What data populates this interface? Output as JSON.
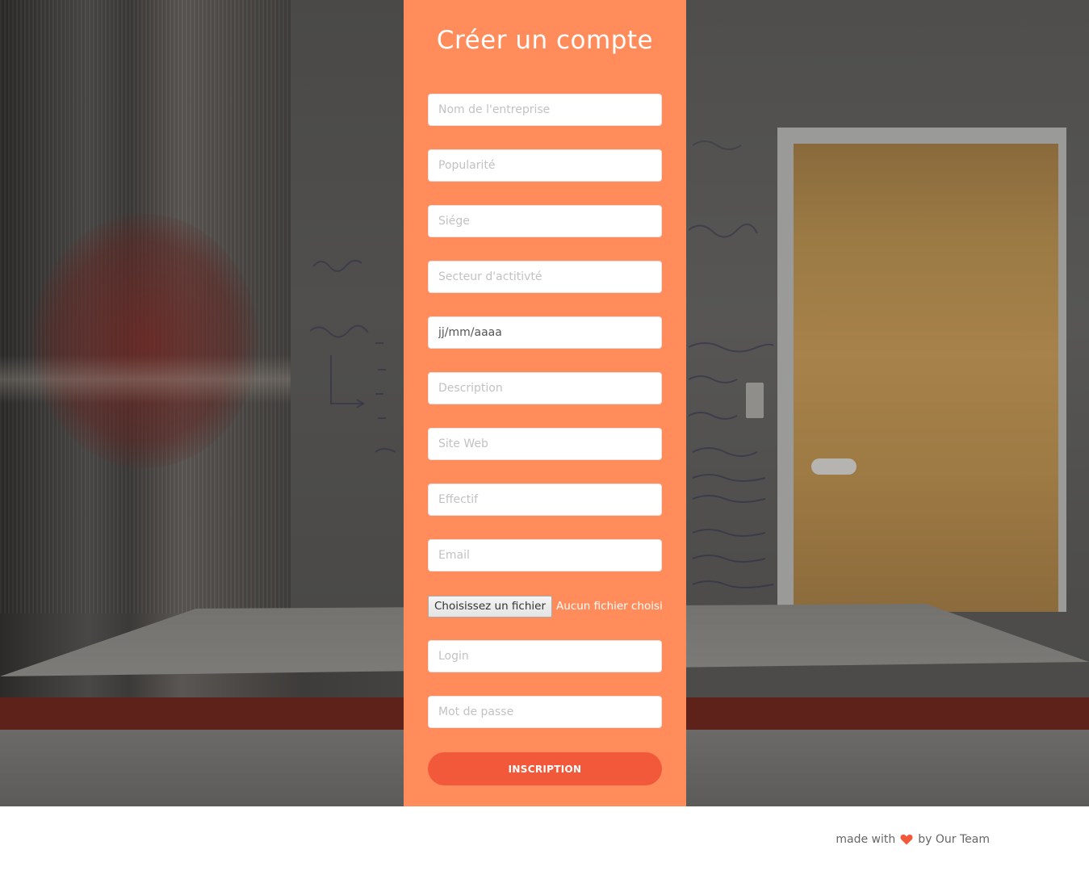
{
  "form": {
    "title": "Créer un compte",
    "fields": {
      "company_name": {
        "placeholder": "Nom de l'entreprise",
        "value": ""
      },
      "popularity": {
        "placeholder": "Popularité",
        "value": ""
      },
      "headquarters": {
        "placeholder": "Siége",
        "value": ""
      },
      "sector": {
        "placeholder": "Secteur d'actitivté",
        "value": ""
      },
      "date": {
        "placeholder": "jj/mm/aaaa",
        "value": ""
      },
      "description": {
        "placeholder": "Description",
        "value": ""
      },
      "website": {
        "placeholder": "Site Web",
        "value": ""
      },
      "headcount": {
        "placeholder": "Effectif",
        "value": ""
      },
      "email": {
        "placeholder": "Email",
        "value": ""
      },
      "login": {
        "placeholder": "Login",
        "value": ""
      },
      "password": {
        "placeholder": "Mot de passe",
        "value": ""
      }
    },
    "file_upload": {
      "button_label": "Choisissez un fichier",
      "status": "Aucun fichier choisi"
    },
    "submit_label": "INSCRIPTION"
  },
  "footer": {
    "made_with": "made with",
    "by": "by Our Team",
    "heart_icon": "heart-icon"
  },
  "colors": {
    "panel": "#ff8c5a",
    "submit": "#f2593a",
    "heart": "#f2593a"
  }
}
